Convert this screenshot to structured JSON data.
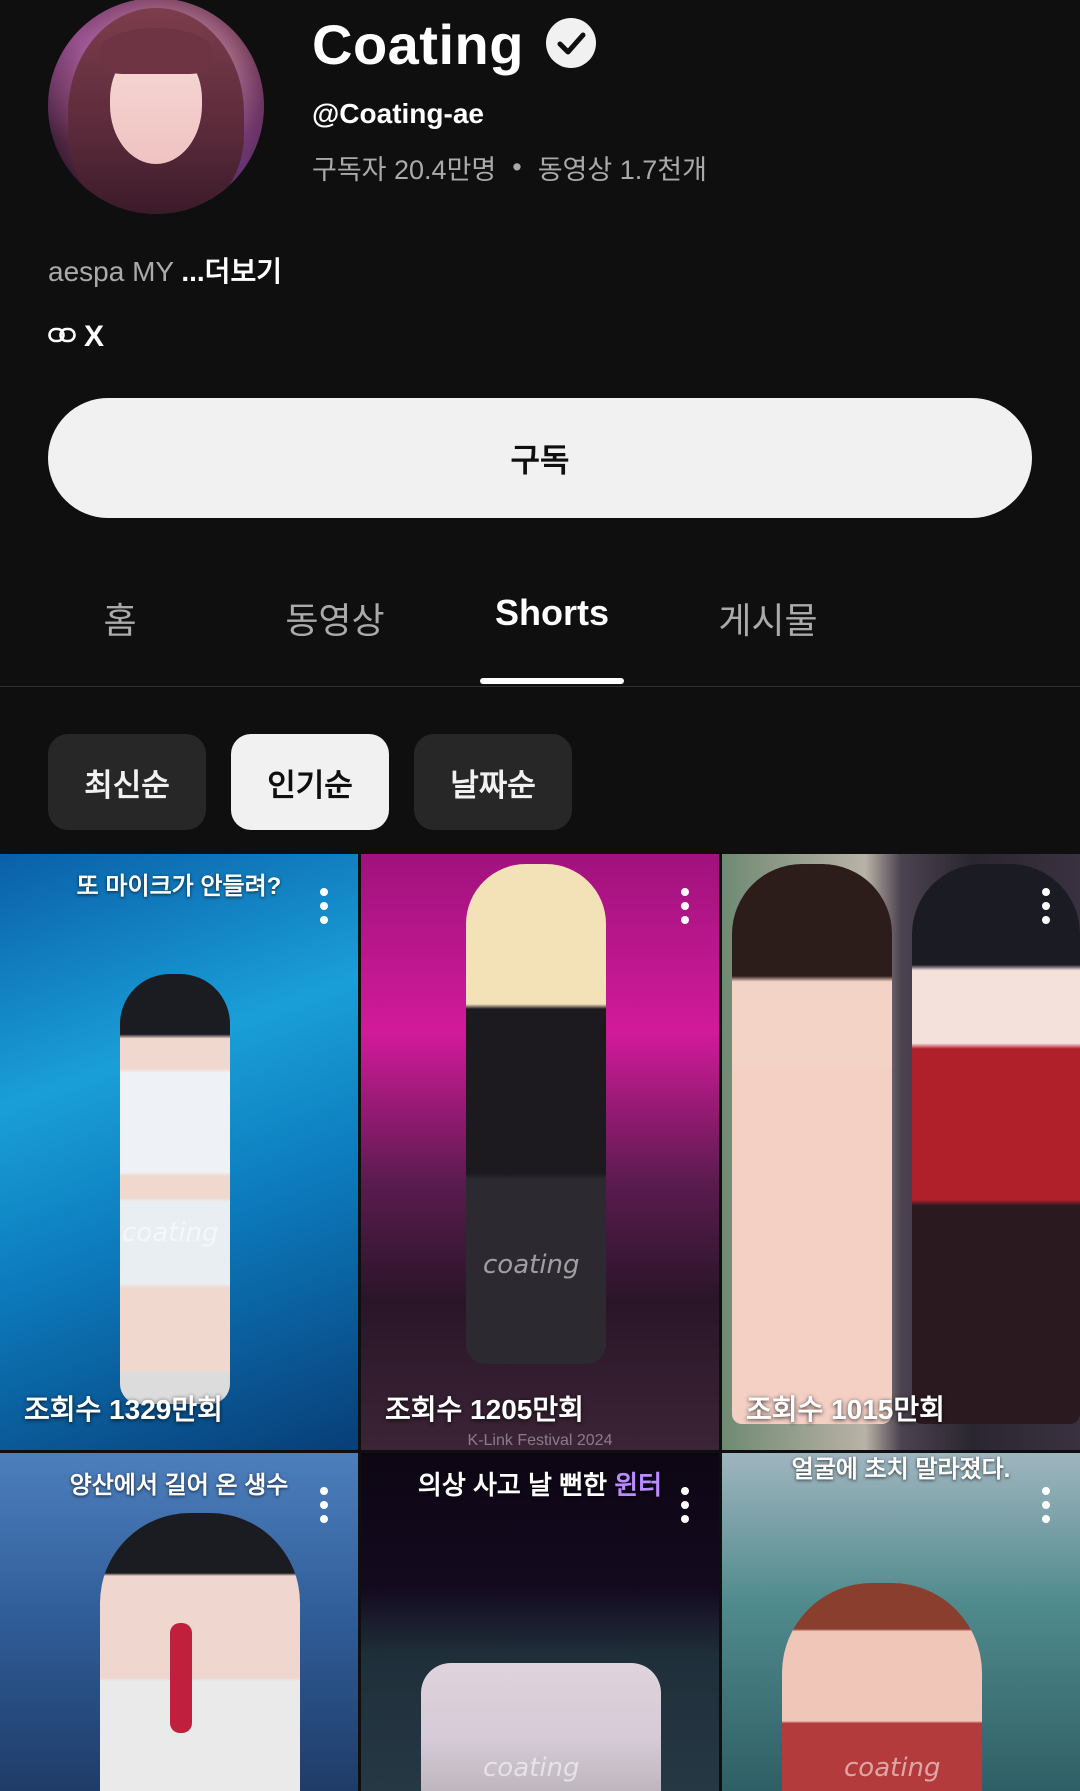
{
  "channel": {
    "name": "Coating",
    "handle": "@Coating-ae",
    "subscribers": "구독자 20.4만명",
    "separator": "•",
    "videos": "동영상 1.7천개",
    "description": "aespa MY ",
    "more_label": "...더보기",
    "link_label": "X",
    "subscribe_label": "구독"
  },
  "tabs": [
    {
      "label": "홈",
      "active": false
    },
    {
      "label": "동영상",
      "active": false
    },
    {
      "label": "Shorts",
      "active": true
    },
    {
      "label": "게시물",
      "active": false
    }
  ],
  "sort_chips": [
    {
      "label": "최신순",
      "selected": false
    },
    {
      "label": "인기순",
      "selected": true
    },
    {
      "label": "날짜순",
      "selected": false
    }
  ],
  "shorts": [
    {
      "title": "또 마이크가 안들려?",
      "views": "조회수 1329만회",
      "watermark": "coating"
    },
    {
      "title": "",
      "views": "조회수 1205만회",
      "watermark": "coating",
      "caption": "K-Link Festival 2024"
    },
    {
      "title": "",
      "views": "조회수 1015만회",
      "watermark": ""
    },
    {
      "title": "양산에서 길어 온 생수",
      "views": "",
      "watermark": ""
    },
    {
      "title_main": "의상 사고 날 뻔한 ",
      "title_highlight": "윈터",
      "views": "",
      "watermark": "coating"
    },
    {
      "title": "얼굴에 초치 말라졌다.",
      "views": "",
      "watermark": "coating"
    }
  ],
  "icons": {
    "verified": "verified-check-icon",
    "link": "link-icon",
    "more": "more-vertical-icon"
  },
  "colors": {
    "background": "#0f0f0f",
    "subscribe_bg": "#f1f1f1",
    "chip_bg": "#272727",
    "secondary_text": "#aaaaaa",
    "highlight": "#b98cff"
  }
}
